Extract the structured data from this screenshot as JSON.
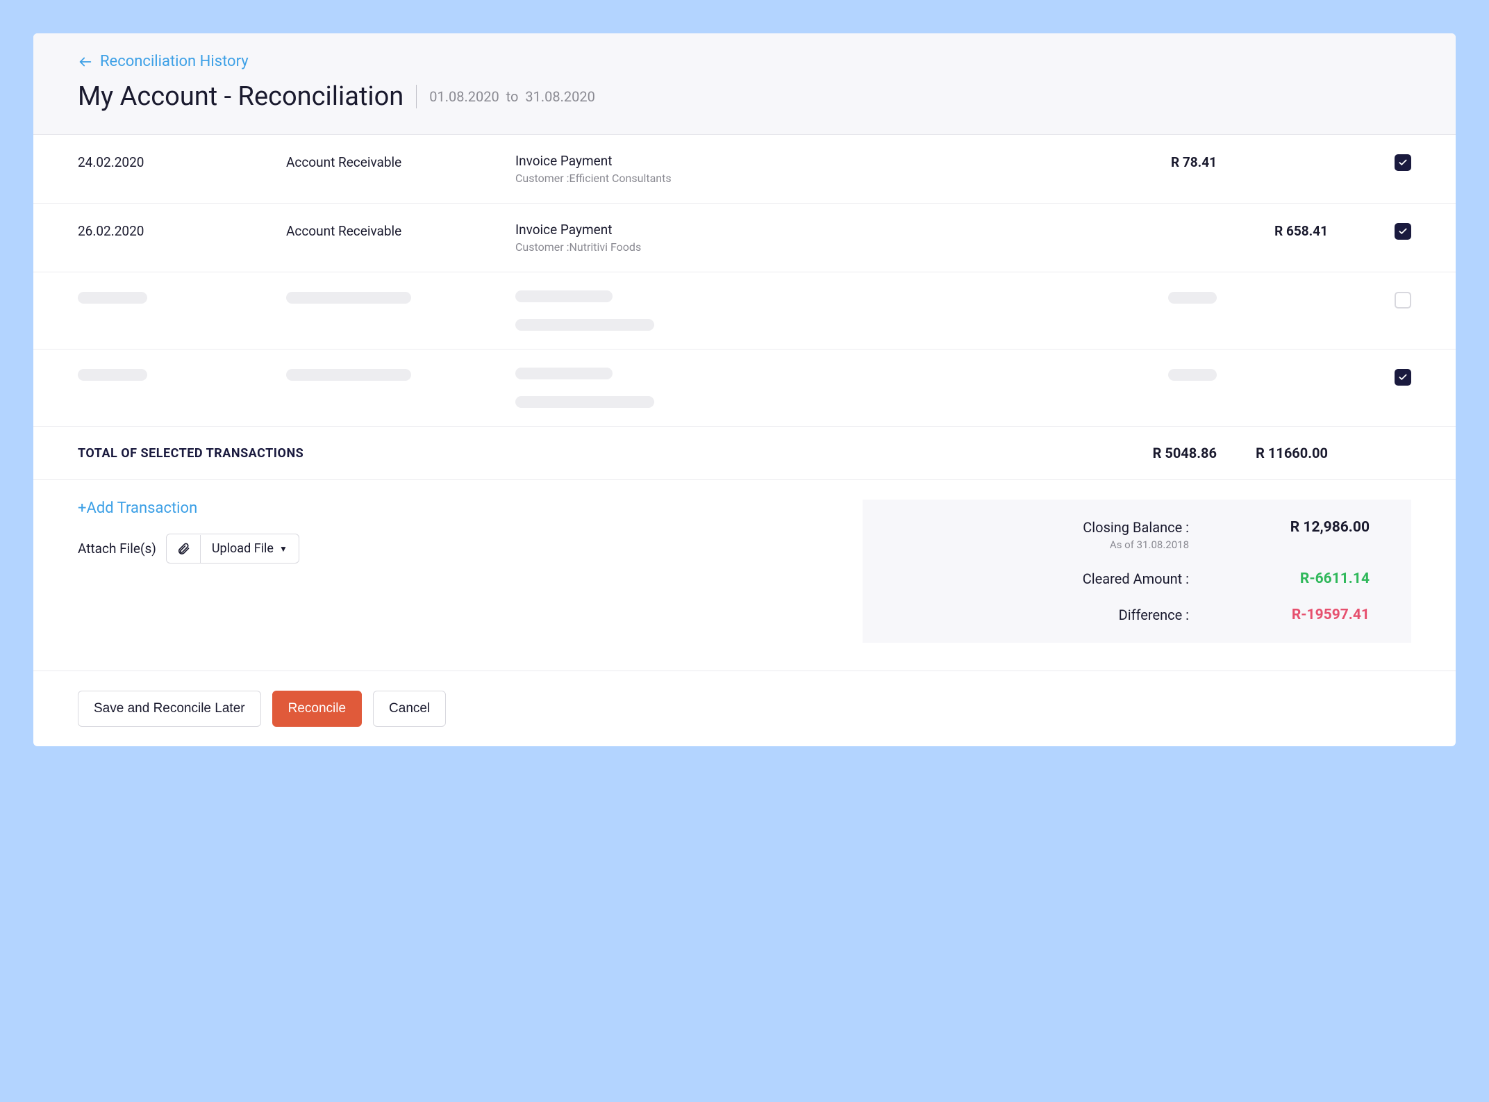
{
  "header": {
    "back_label": "Reconciliation History",
    "page_title": "My Account - Reconciliation",
    "date_from": "01.08.2020",
    "date_to_word": "to",
    "date_to": "31.08.2020"
  },
  "transactions": [
    {
      "date": "24.02.2020",
      "account": "Account Receivable",
      "desc": "Invoice Payment",
      "sub": "Customer :Efficient Consultants",
      "amount1": "R 78.41",
      "amount2": "",
      "checked": true
    },
    {
      "date": "26.02.2020",
      "account": "Account Receivable",
      "desc": "Invoice Payment",
      "sub": "Customer :Nutritivi Foods",
      "amount1": "",
      "amount2": "R 658.41",
      "checked": true
    }
  ],
  "skeleton_rows": [
    {
      "checked": false
    },
    {
      "checked": true
    }
  ],
  "totals": {
    "label": "TOTAL OF SELECTED TRANSACTIONS",
    "amount1": "R 5048.86",
    "amount2": "R 11660.00"
  },
  "bottom": {
    "add_label": "+Add Transaction",
    "attach_label": "Attach File(s)",
    "upload_label": "Upload File"
  },
  "summary": {
    "closing_label": "Closing Balance :",
    "closing_sub": "As of 31.08.2018",
    "closing_value": "R 12,986.00",
    "cleared_label": "Cleared Amount :",
    "cleared_value": "R-6611.14",
    "diff_label": "Difference :",
    "diff_value": "R-19597.41"
  },
  "footer": {
    "save_label": "Save and Reconcile Later",
    "reconcile_label": "Reconcile",
    "cancel_label": "Cancel"
  }
}
